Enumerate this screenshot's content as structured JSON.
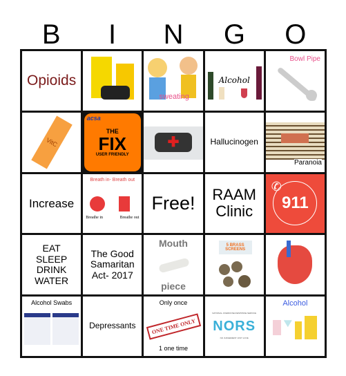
{
  "header": {
    "letters": [
      "B",
      "I",
      "N",
      "G",
      "O"
    ]
  },
  "cells": {
    "opioids": "Opioids",
    "sweating": "sweating",
    "alcohol_art": "Alcohol",
    "bowl_pipe": "Bowl Pipe",
    "vitc": "VitC",
    "fix": {
      "brand": "acsa",
      "title1": "THE",
      "title2": "FIX",
      "sub": "USER FRIENDLY"
    },
    "hallucinogen": "Hallucinogen",
    "paranoia": "Paranoia",
    "increase": "Increase",
    "breath": {
      "title": "Breath in- Breath out",
      "in": "Breathe in",
      "out": "Breathe out"
    },
    "free": "Free!",
    "raam": "RAAM Clinic",
    "n911": "911",
    "eat": "EAT SLEEP DRINK WATER",
    "samaritan": "The Good Samaritan Act- 2017",
    "mouth1": "Mouth",
    "mouth2": "piece",
    "screens": "5 BRASS SCREENS",
    "swabs": "Alcohol Swabs",
    "depressants": "Depressants",
    "once_top": "Only once",
    "once_stamp": "ONE TIME ONLY",
    "once_bottom": "1 one time",
    "nors": {
      "top": "NATIONAL OVERDOSE RESPONSE SERVICE",
      "logo": "NORS",
      "bottom": "NO JUDGEMENT JUST LOVE"
    },
    "alcohol2": "Alcohol"
  },
  "colors": {
    "opioids": "#7a1a1a",
    "pink": "#e8508a",
    "red911": "#ee4b3b",
    "orange": "#ff7a00",
    "blue": "#3a5be0"
  }
}
